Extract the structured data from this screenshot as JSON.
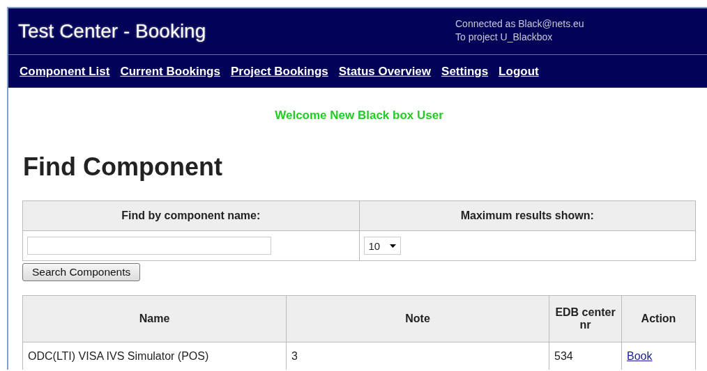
{
  "header": {
    "title": "Test Center - Booking",
    "connected": "Connected as Black@nets.eu",
    "project": "To project U_Blackbox"
  },
  "nav": [
    {
      "label": "Component List"
    },
    {
      "label": "Current Bookings"
    },
    {
      "label": "Project Bookings"
    },
    {
      "label": "Status Overview"
    },
    {
      "label": "Settings"
    },
    {
      "label": "Logout"
    }
  ],
  "welcome": "Welcome New Black box User",
  "heading": "Find Component",
  "search": {
    "name_label": "Find by component name:",
    "max_label": "Maximum results shown:",
    "max_value": "10",
    "button": "Search Components"
  },
  "results": {
    "columns": [
      "Name",
      "Note",
      "EDB center nr",
      "Action"
    ],
    "rows": [
      {
        "name": "ODC(LTI) VISA IVS Simulator (POS)",
        "note": "3",
        "edb": "534",
        "action": "Book"
      }
    ]
  }
}
